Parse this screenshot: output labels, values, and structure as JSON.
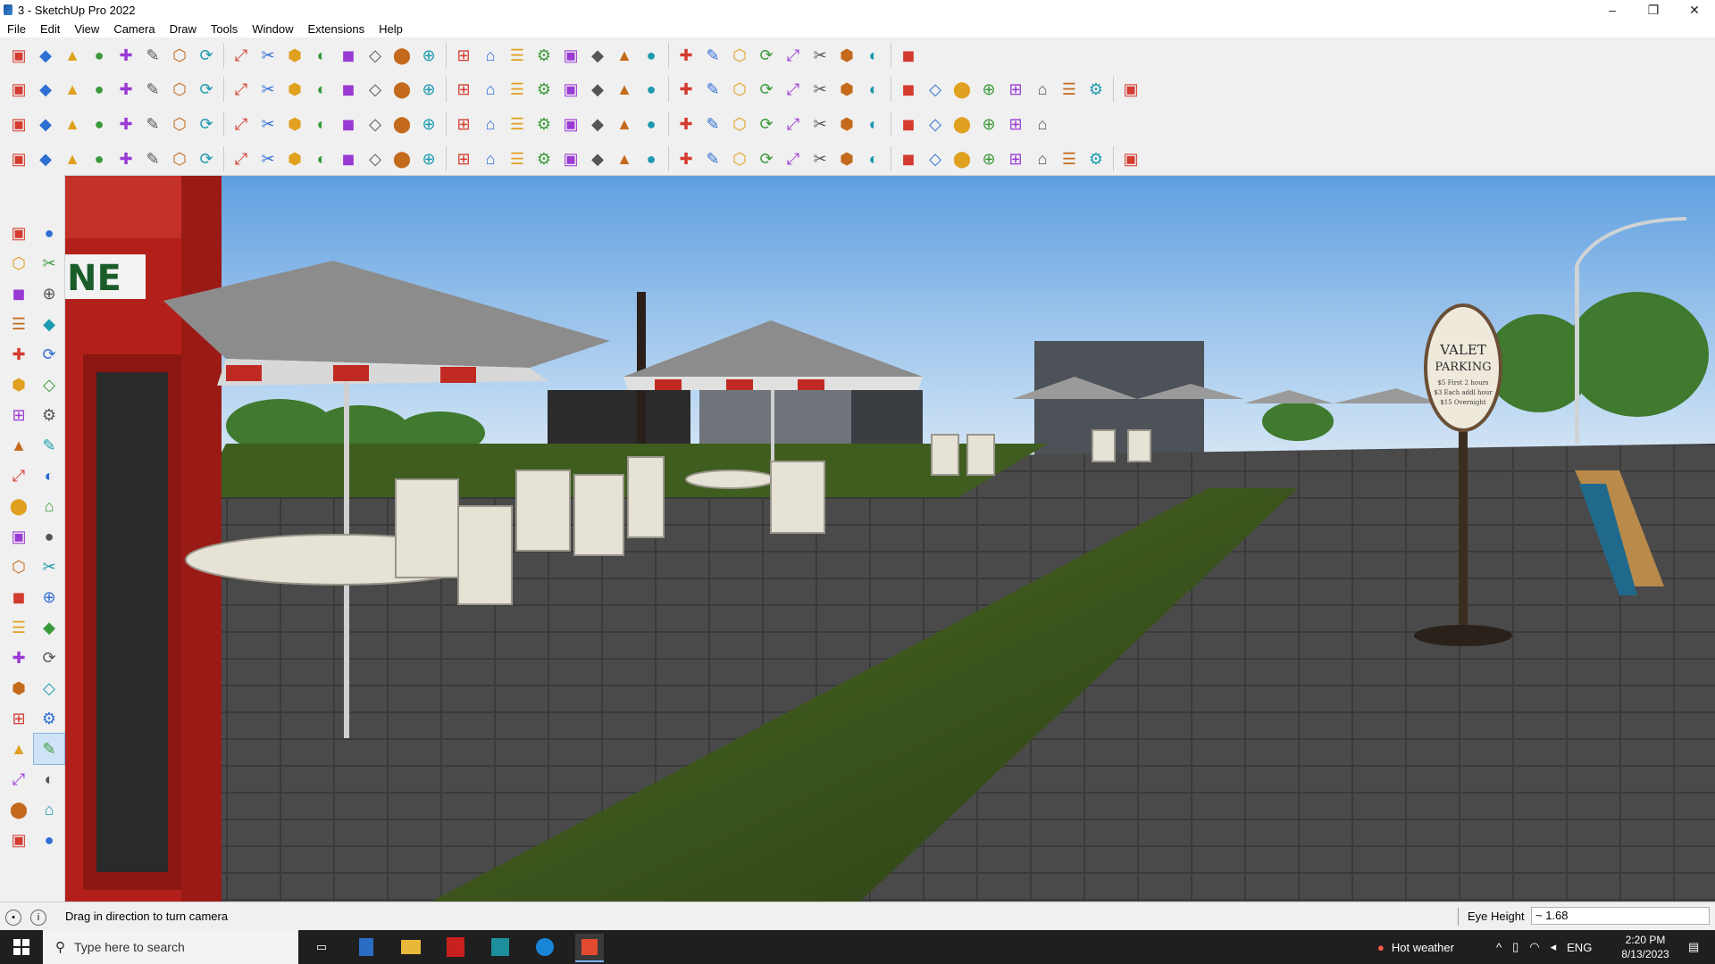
{
  "window": {
    "title": "3 - SketchUp Pro 2022",
    "controls": [
      "minimize",
      "restore",
      "close"
    ]
  },
  "menu": [
    "File",
    "Edit",
    "View",
    "Camera",
    "Draw",
    "Tools",
    "Window",
    "Extensions",
    "Help"
  ],
  "toolbars": {
    "row1": [
      "zoom-extents-icon",
      "select-icon",
      "eraser-icon",
      "line-icon",
      "arc-icon",
      "rectangle-icon",
      "push-pull-icon",
      "follow-me-icon",
      "move-icon",
      "rotate-icon",
      "scale-icon",
      "tape-measure-icon",
      "text-icon",
      "paint-bucket-icon",
      "orbit-icon",
      "pan-icon",
      "zoom-icon",
      "zoom-window-icon",
      "components-icon",
      "sandbox-icon",
      "layers-icon",
      "styles-icon",
      "account-icon",
      "warehouse-icon",
      "extension-warehouse-icon",
      "layout-icon",
      "up-arrows-icon",
      "down-arrows-icon",
      "dimension-icon",
      "section-icon",
      "undo-icon",
      "redo-icon",
      "solid-tools-icon"
    ],
    "row2": [
      "iso-view-icon",
      "top-view-icon",
      "front-view-icon",
      "move-axis-icon",
      "drop-icon",
      "axes-icon",
      "intersect-icon",
      "union-icon",
      "subtract-icon",
      "trim-icon",
      "split-icon",
      "curve-icon",
      "section-plane-icon",
      "section-cut-icon",
      "section-fill-icon",
      "terrain-icon",
      "place-icon",
      "house-icon",
      "building-icon",
      "roof-icon",
      "home-icon",
      "garage-icon",
      "formula-icon",
      "pencil-tag-icon",
      "rect-shape-icon",
      "circle-shape-icon",
      "hexagon-shape-icon",
      "ellipse-shape-icon",
      "parallelogram-shape-icon",
      "arch-shape-icon",
      "spiral-icon",
      "bezier-icon",
      "polygon-icon",
      "eraser-red-icon",
      "wood-icon",
      "grid-icon",
      "stairs-icon",
      "truss-icon",
      "bucket-icon",
      "glass-icon",
      "roof-tile-icon"
    ],
    "row3": [
      "blue-plane-icon",
      "cyan-plane-icon",
      "yellow-plane-icon",
      "green-plane-icon",
      "red-plane-icon",
      "paper-icon",
      "orange-arc-icon",
      "red-square-icon",
      "grid-table-icon",
      "panel-icon",
      "box-icon",
      "pipe-icon",
      "polyline-icon",
      "red-cross-icon",
      "green-cross-icon",
      "blue-x-icon",
      "cone-icon",
      "spike-icon",
      "pyramid-icon",
      "hook-icon",
      "clip-icon",
      "loop-icon",
      "sparkle-icon",
      "cup-icon",
      "red-loop-icon",
      "tree-icon",
      "move-group-icon",
      "component-icon",
      "duplicate-icon",
      "red-tag-icon",
      "flower-icon",
      "frame-icon",
      "orange-grid-icon",
      "window-icon",
      "grid-box-icon",
      "close-cross-icon",
      "arc-path-icon",
      "qr-icon"
    ],
    "row4": [
      "bounding-box-icon",
      "path-icon",
      "vehicle-icon",
      "scissors-icon",
      "gear-icon",
      "lasso-icon",
      "wire-icon",
      "cube-wire-icon",
      "sphere-wire-icon",
      "twist-icon",
      "stair-rail-icon",
      "railing-icon",
      "line-red-icon",
      "curve-red-icon",
      "bench-icon",
      "chair-icon",
      "column-icon",
      "fence-icon",
      "slats-icon",
      "ribs-icon",
      "wall-icon",
      "arrow-left-icon",
      "stack-icon",
      "slash-icon",
      "fork-icon",
      "tines-icon",
      "branches-icon",
      "desk-icon",
      "stair-steps-icon",
      "brick-icon",
      "bracket-icon",
      "pillar-icon",
      "grate-icon",
      "mesh-icon",
      "louver-icon",
      "picket-icon",
      "wheel-icon",
      "wreath-icon",
      "tilt-icon",
      "burst-icon",
      "pentagon-icon"
    ]
  },
  "left_tools": [
    "select-tool-icon",
    "orbit-tool-icon",
    "paint-tool-icon",
    "eraser-tool-icon",
    "component-tool-icon",
    "pencil-tool-icon",
    "line-tool-icon",
    "freehand-tool-icon",
    "rectangle-tool-icon",
    "rotated-rect-tool-icon",
    "circle-tool-icon",
    "polygon-tool-icon",
    "arc-tool-icon",
    "pie-tool-icon",
    "three-point-arc-icon",
    "two-point-arc-icon",
    "move-tool-icon",
    "pushpull-tool-icon",
    "rotate-tool-icon",
    "followme-tool-icon",
    "scale-tool-icon",
    "offset-tool-icon",
    "tape-tool-icon",
    "dimension-tool-icon",
    "protractor-tool-icon",
    "text-tool-icon",
    "axes-tool-icon",
    "3dtext-tool-icon",
    "orbit2-tool-icon",
    "pan-tool-icon",
    "zoom-tool-icon",
    "zoom-window-tool-icon",
    "zoom-extents-tool-icon",
    "previous-view-icon",
    "position-camera-icon",
    "look-around-icon",
    "walk-tool-icon",
    "section-tool-icon",
    "sandbox-tool-icon",
    "stamp-tool-icon",
    "drape-tool-icon",
    "flip-edge-icon"
  ],
  "scene": {
    "phone_box_sign": "NE",
    "valet_sign": [
      "VALET",
      "PARKING",
      "$5 First 2 hours",
      "$3 Each addl hour",
      "$15 Overnight"
    ]
  },
  "status": {
    "message": "Drag in direction to turn camera",
    "vcb_label": "Eye Height",
    "vcb_value": "~ 1.68"
  },
  "taskbar": {
    "search_placeholder": "Type here to search",
    "weather": "Hot weather",
    "language": "ENG",
    "time": "2:20 PM",
    "date": "8/13/2023"
  }
}
